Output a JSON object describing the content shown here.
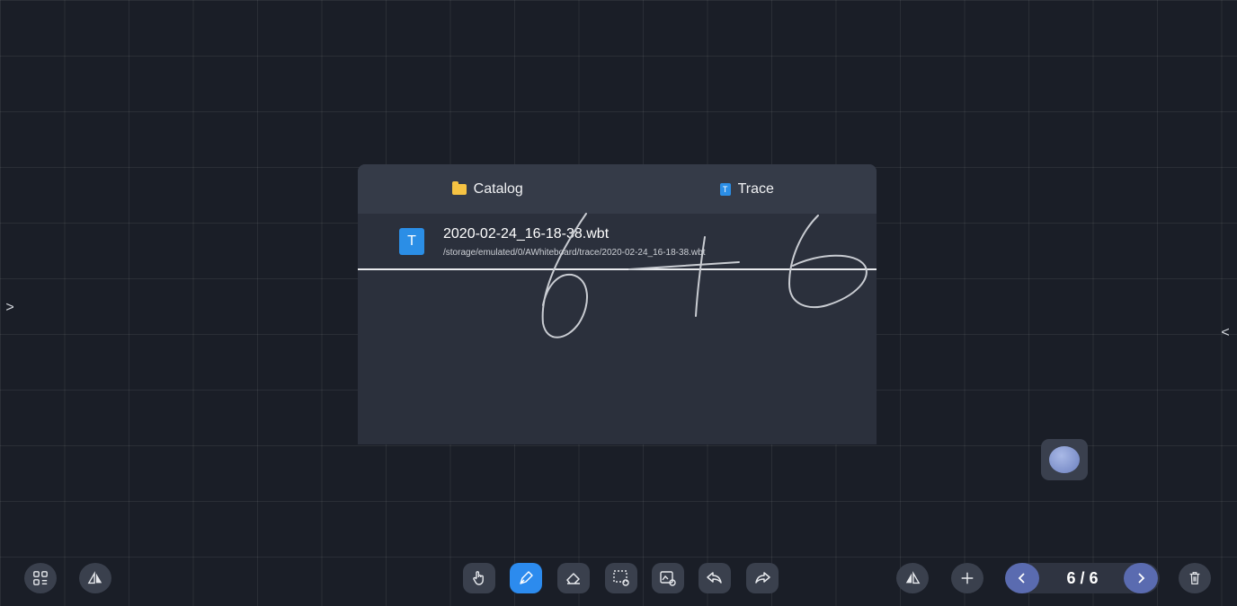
{
  "panel": {
    "tabs": [
      {
        "label": "Catalog",
        "icon": "folder-icon"
      },
      {
        "label": "Trace",
        "icon": "file-icon",
        "icon_letter": "T"
      }
    ],
    "files": [
      {
        "icon_letter": "T",
        "name": "2020-02-24_16-18-38.wbt",
        "path": "/storage/emulated/0/AWhiteboard/trace/2020-02-24_16-18-38.wbt"
      }
    ]
  },
  "pager": {
    "label": "6 / 6",
    "current": 6,
    "total": 6
  },
  "colors": {
    "background": "#1a1e27",
    "accent": "#2c8bee",
    "pager_nav": "#5a6bb0",
    "file_icon": "#2b8ee6",
    "folder_icon": "#f6c343"
  },
  "toolbar_icons": {
    "left": [
      "grid-menu-icon",
      "shape-mirror-icon"
    ],
    "center": [
      "hand-icon",
      "pen-icon",
      "eraser-icon",
      "lasso-select-icon",
      "image-settings-icon",
      "undo-icon",
      "redo-icon"
    ],
    "right": [
      "mirror-icon",
      "add-page-icon",
      "previous-page-icon",
      "next-page-icon",
      "delete-icon"
    ]
  }
}
